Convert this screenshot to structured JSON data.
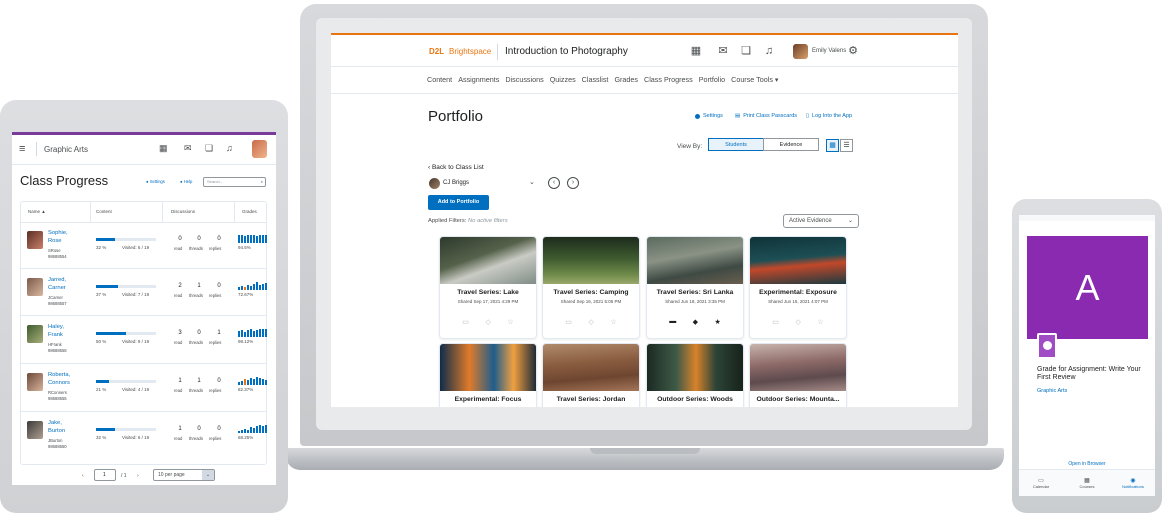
{
  "laptop": {
    "header": {
      "logo_d2l": "D2L",
      "logo_brand": "Brightspace",
      "course_title": "Introduction to Photography",
      "user_name": "Emily Valens"
    },
    "nav": [
      "Content",
      "Assignments",
      "Discussions",
      "Quizzes",
      "Classlist",
      "Grades",
      "Class Progress",
      "Portfolio",
      "Course Tools ▾"
    ],
    "page_title": "Portfolio",
    "tools": {
      "settings": "Settings",
      "print": "Print Class Passcards",
      "login": "Log Into the App"
    },
    "view_by_label": "View By:",
    "view_options": [
      "Students",
      "Evidence"
    ],
    "back_link": "‹ Back to Class List",
    "student_name": "CJ Briggs",
    "add_button": "Add to Portfolio",
    "applied_filters_label": "Applied Filters:",
    "applied_filters_value": "No active filters",
    "filter_dropdown": "Active Evidence",
    "cards": [
      {
        "title": "Travel Series: Lake",
        "shared": "Shared Sep 17, 2021 4:29 PM"
      },
      {
        "title": "Travel Series: Camping",
        "shared": "Shared Sep 16, 2021 5:05 PM"
      },
      {
        "title": "Travel Series: Sri Lanka",
        "shared": "Shared Jun 18, 2021 3:35 PM"
      },
      {
        "title": "Experimental: Exposure",
        "shared": "Shared Jun 15, 2021 4:07 PM"
      },
      {
        "title": "Experimental: Focus",
        "shared": ""
      },
      {
        "title": "Travel Series: Jordan",
        "shared": ""
      },
      {
        "title": "Outdoor Series: Woods",
        "shared": ""
      },
      {
        "title": "Outdoor Series: Mounta...",
        "shared": ""
      }
    ]
  },
  "tablet": {
    "header_title": "Graphic Arts",
    "page_title": "Class Progress",
    "settings_link": "Settings",
    "help_link": "Help",
    "search_placeholder": "Search...",
    "columns": [
      "Name ▲",
      "Content",
      "Discussions",
      "Grades"
    ],
    "rows": [
      {
        "first": "Sophie,",
        "last": "Rose",
        "user": "SRose",
        "id": "98688554",
        "content_pct_label": "32 %",
        "visited": "Visited: 6 / 19",
        "read": "0",
        "threads": "0",
        "replies": "0",
        "grade": "94.5%"
      },
      {
        "first": "Jarred,",
        "last": "Carner",
        "user": "JCarner",
        "id": "98688557",
        "content_pct_label": "37 %",
        "visited": "Visited: 7 / 19",
        "read": "2",
        "threads": "1",
        "replies": "0",
        "grade": "72.67%"
      },
      {
        "first": "Haley,",
        "last": "Frank",
        "user": "HFrank",
        "id": "98688558",
        "content_pct_label": "50 %",
        "visited": "Visited: 9 / 19",
        "read": "3",
        "threads": "0",
        "replies": "1",
        "grade": "98.12%"
      },
      {
        "first": "Roberta,",
        "last": "Connors",
        "user": "RConners",
        "id": "98688555",
        "content_pct_label": "21 %",
        "visited": "Visited: 4 / 19",
        "read": "1",
        "threads": "1",
        "replies": "0",
        "grade": "82.37%"
      },
      {
        "first": "Jake,",
        "last": "Burton",
        "user": "JBurton",
        "id": "98688550",
        "content_pct_label": "32 %",
        "visited": "Visited: 6 / 19",
        "read": "1",
        "threads": "0",
        "replies": "0",
        "grade": "68.25%"
      }
    ],
    "col_labels": {
      "read": "read",
      "threads": "threads",
      "replies": "replies"
    },
    "pager": {
      "prev": "‹",
      "page": "1",
      "of": "/ 1",
      "next": "›",
      "per_page": "10 per page"
    }
  },
  "phone": {
    "tile_letter": "A",
    "notification_text": "Grade for Assignment: Write Your First Review",
    "course": "Graphic Arts",
    "open_link": "Open in Browser",
    "tabs": [
      "Calendar",
      "Courses",
      "Notifications"
    ]
  }
}
